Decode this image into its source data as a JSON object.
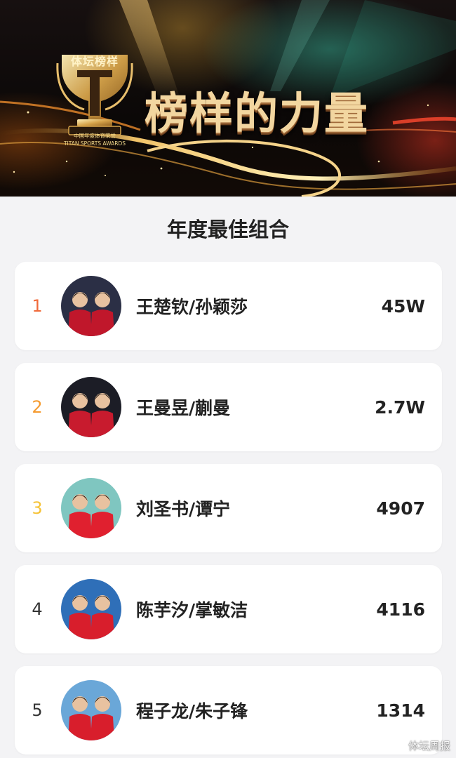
{
  "banner": {
    "badge": "体坛榜样",
    "subtitle": "中国年度体育荣誉",
    "subtitle_en": "TITAN SPORTS AWARDS",
    "title": "榜样的力量"
  },
  "section": {
    "title": "年度最佳组合"
  },
  "rankings": [
    {
      "rank": "1",
      "names": "王楚钦/孙颖莎",
      "score": "45W",
      "rank_color": "#f06a3a",
      "avatar_bg": "#2b2f45",
      "shirt": "#c0172b"
    },
    {
      "rank": "2",
      "names": "王曼昱/蒯曼",
      "score": "2.7W",
      "rank_color": "#f59a2e",
      "avatar_bg": "#1c1d26",
      "shirt": "#c81b2e"
    },
    {
      "rank": "3",
      "names": "刘圣书/谭宁",
      "score": "4907",
      "rank_color": "#f6c338",
      "avatar_bg": "#7fc6c0",
      "shirt": "#e0202f"
    },
    {
      "rank": "4",
      "names": "陈芋汐/掌敏洁",
      "score": "4116",
      "rank_color": "#333333",
      "avatar_bg": "#2f6fb8",
      "shirt": "#d81e2c"
    },
    {
      "rank": "5",
      "names": "程子龙/朱子锋",
      "score": "1314",
      "rank_color": "#333333",
      "avatar_bg": "#6aa7d8",
      "shirt": "#d81e2c"
    }
  ],
  "watermark": {
    "text": "体坛周报",
    "icon": "weibo-icon"
  }
}
